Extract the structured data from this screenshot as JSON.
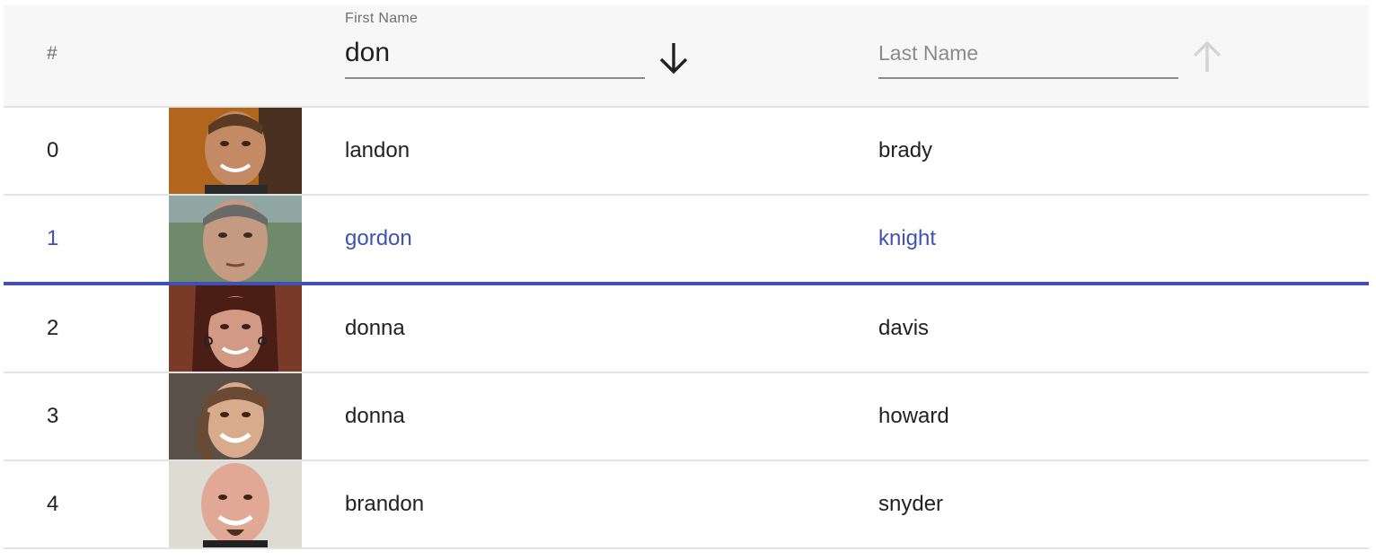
{
  "header": {
    "index_label": "#",
    "first_name": {
      "label": "First Name",
      "value": "don",
      "sort_icon": "arrow-down-icon",
      "sort_direction": "descending",
      "sort_active": true
    },
    "last_name": {
      "placeholder": "Last Name",
      "value": "",
      "sort_icon": "arrow-up-icon",
      "sort_active": false
    }
  },
  "colors": {
    "accent": "#3f51b5",
    "header_bg": "#f7f7f7",
    "divider": "#e2e2e2",
    "text": "#212121",
    "muted": "#6f6f6f"
  },
  "rows": [
    {
      "index": "0",
      "first": "landon",
      "last": "brady",
      "selected": false
    },
    {
      "index": "1",
      "first": "gordon",
      "last": "knight",
      "selected": true
    },
    {
      "index": "2",
      "first": "donna",
      "last": "davis",
      "selected": false
    },
    {
      "index": "3",
      "first": "donna",
      "last": "howard",
      "selected": false
    },
    {
      "index": "4",
      "first": "brandon",
      "last": "snyder",
      "selected": false
    }
  ]
}
